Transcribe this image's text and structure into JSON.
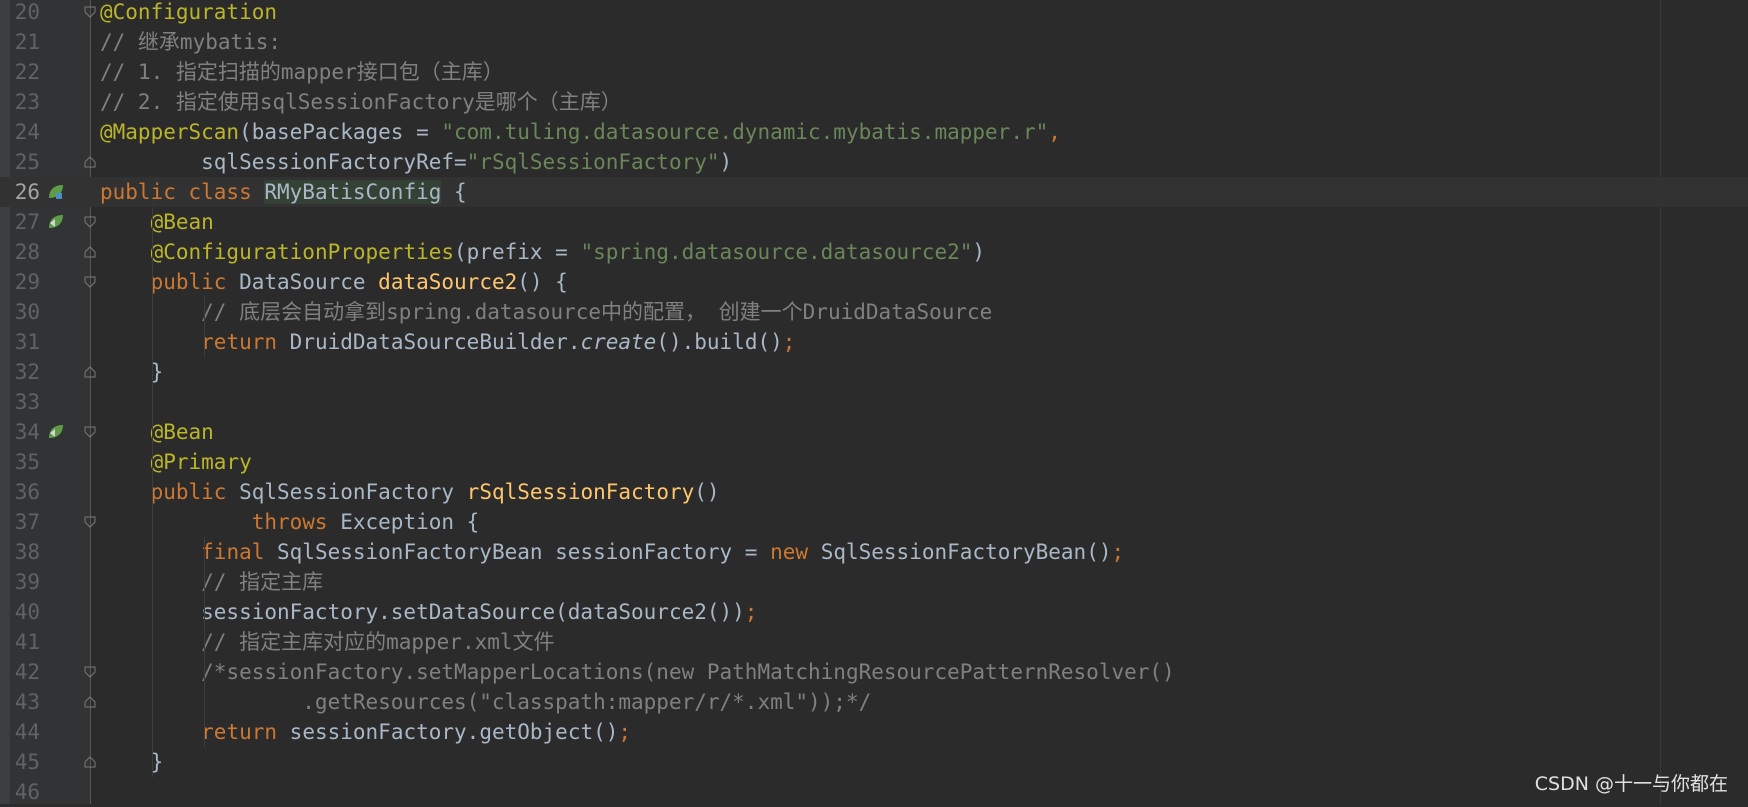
{
  "editor": {
    "language": "java",
    "current_line": 26,
    "colors": {
      "background": "#2b2b2b",
      "gutter": "#313335",
      "line_number": "#606366",
      "plain": "#a9b7c6",
      "annotation": "#bbb529",
      "comment": "#808080",
      "keyword": "#cc7832",
      "string": "#6a8759",
      "method": "#ffc66d"
    },
    "lines": [
      {
        "n": 20,
        "fold": "open",
        "icon": null,
        "tokens": [
          [
            "annotation",
            "@Configuration"
          ]
        ]
      },
      {
        "n": 21,
        "fold": null,
        "icon": null,
        "tokens": [
          [
            "comment",
            "// 继承mybatis:"
          ]
        ]
      },
      {
        "n": 22,
        "fold": null,
        "icon": null,
        "tokens": [
          [
            "comment",
            "// 1. 指定扫描的mapper接口包（主库）"
          ]
        ]
      },
      {
        "n": 23,
        "fold": null,
        "icon": null,
        "tokens": [
          [
            "comment",
            "// 2. 指定使用sqlSessionFactory是哪个（主库）"
          ]
        ]
      },
      {
        "n": 24,
        "fold": null,
        "icon": null,
        "tokens": [
          [
            "annotation",
            "@MapperScan"
          ],
          [
            "plain",
            "(basePackages = "
          ],
          [
            "string",
            "\"com.tuling.datasource.dynamic.mybatis.mapper.r\""
          ],
          [
            "keyword",
            ","
          ]
        ]
      },
      {
        "n": 25,
        "fold": "close",
        "icon": null,
        "tokens": [
          [
            "plain",
            "        sqlSessionFactoryRef="
          ],
          [
            "string",
            "\"rSqlSessionFactory\""
          ],
          [
            "plain",
            ")"
          ]
        ]
      },
      {
        "n": 26,
        "fold": null,
        "icon": "bean-class-icon",
        "tokens": [
          [
            "keyword",
            "public class "
          ],
          [
            "classname",
            "RMyBatisConfig"
          ],
          [
            "plain",
            " {"
          ]
        ]
      },
      {
        "n": 27,
        "fold": "open",
        "icon": "bean-method-icon",
        "tokens": [
          [
            "plain",
            "    "
          ],
          [
            "annotation",
            "@Bean"
          ]
        ]
      },
      {
        "n": 28,
        "fold": "close",
        "icon": null,
        "tokens": [
          [
            "plain",
            "    "
          ],
          [
            "annotation",
            "@ConfigurationProperties"
          ],
          [
            "plain",
            "(prefix = "
          ],
          [
            "string",
            "\"spring.datasource.datasource2\""
          ],
          [
            "plain",
            ")"
          ]
        ]
      },
      {
        "n": 29,
        "fold": "open",
        "icon": null,
        "tokens": [
          [
            "plain",
            "    "
          ],
          [
            "keyword",
            "public "
          ],
          [
            "plain",
            "DataSource "
          ],
          [
            "method",
            "dataSource2"
          ],
          [
            "plain",
            "() {"
          ]
        ]
      },
      {
        "n": 30,
        "fold": null,
        "icon": null,
        "tokens": [
          [
            "plain",
            "        "
          ],
          [
            "comment",
            "// 底层会自动拿到spring.datasource中的配置， 创建一个DruidDataSource"
          ]
        ]
      },
      {
        "n": 31,
        "fold": null,
        "icon": null,
        "tokens": [
          [
            "plain",
            "        "
          ],
          [
            "keyword",
            "return "
          ],
          [
            "plain",
            "DruidDataSourceBuilder."
          ],
          [
            "italic",
            "create"
          ],
          [
            "plain",
            "().build()"
          ],
          [
            "keyword",
            ";"
          ]
        ]
      },
      {
        "n": 32,
        "fold": "close",
        "icon": null,
        "tokens": [
          [
            "plain",
            "    }"
          ]
        ]
      },
      {
        "n": 33,
        "fold": null,
        "icon": null,
        "tokens": []
      },
      {
        "n": 34,
        "fold": "open",
        "icon": "bean-method-icon",
        "tokens": [
          [
            "plain",
            "    "
          ],
          [
            "annotation",
            "@Bean"
          ]
        ]
      },
      {
        "n": 35,
        "fold": null,
        "icon": null,
        "tokens": [
          [
            "plain",
            "    "
          ],
          [
            "annotation",
            "@Primary"
          ]
        ]
      },
      {
        "n": 36,
        "fold": null,
        "icon": null,
        "tokens": [
          [
            "plain",
            "    "
          ],
          [
            "keyword",
            "public "
          ],
          [
            "plain",
            "SqlSessionFactory "
          ],
          [
            "method",
            "rSqlSessionFactory"
          ],
          [
            "plain",
            "()"
          ]
        ]
      },
      {
        "n": 37,
        "fold": "open",
        "icon": null,
        "tokens": [
          [
            "plain",
            "            "
          ],
          [
            "keyword",
            "throws "
          ],
          [
            "plain",
            "Exception {"
          ]
        ]
      },
      {
        "n": 38,
        "fold": null,
        "icon": null,
        "tokens": [
          [
            "plain",
            "        "
          ],
          [
            "keyword",
            "final "
          ],
          [
            "plain",
            "SqlSessionFactoryBean sessionFactory = "
          ],
          [
            "keyword",
            "new "
          ],
          [
            "plain",
            "SqlSessionFactoryBean()"
          ],
          [
            "keyword",
            ";"
          ]
        ]
      },
      {
        "n": 39,
        "fold": null,
        "icon": null,
        "tokens": [
          [
            "plain",
            "        "
          ],
          [
            "comment",
            "// 指定主库"
          ]
        ]
      },
      {
        "n": 40,
        "fold": null,
        "icon": null,
        "tokens": [
          [
            "plain",
            "        sessionFactory.setDataSource(dataSource2())"
          ],
          [
            "keyword",
            ";"
          ]
        ]
      },
      {
        "n": 41,
        "fold": null,
        "icon": null,
        "tokens": [
          [
            "plain",
            "        "
          ],
          [
            "comment",
            "// 指定主库对应的mapper.xml文件"
          ]
        ]
      },
      {
        "n": 42,
        "fold": "open",
        "icon": null,
        "tokens": [
          [
            "plain",
            "        "
          ],
          [
            "comment",
            "/*sessionFactory.setMapperLocations(new PathMatchingResourcePatternResolver()"
          ]
        ]
      },
      {
        "n": 43,
        "fold": "close",
        "icon": null,
        "tokens": [
          [
            "comment",
            "                .getResources(\"classpath:mapper/r/*.xml\"));*/"
          ]
        ]
      },
      {
        "n": 44,
        "fold": null,
        "icon": null,
        "tokens": [
          [
            "plain",
            "        "
          ],
          [
            "keyword",
            "return "
          ],
          [
            "plain",
            "sessionFactory.getObject()"
          ],
          [
            "keyword",
            ";"
          ]
        ]
      },
      {
        "n": 45,
        "fold": "close",
        "icon": null,
        "tokens": [
          [
            "plain",
            "    }"
          ]
        ]
      },
      {
        "n": 46,
        "fold": null,
        "icon": null,
        "tokens": []
      }
    ]
  },
  "watermark": "CSDN @十一与你都在"
}
